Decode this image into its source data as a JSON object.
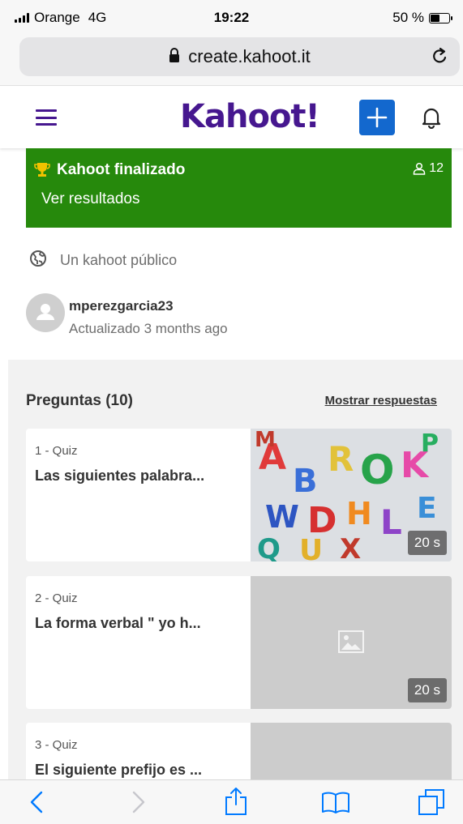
{
  "status_bar": {
    "carrier": "Orange",
    "network": "4G",
    "time": "19:22",
    "battery_text": "50 %",
    "battery_level": 0.5
  },
  "browser": {
    "url": "create.kahoot.it"
  },
  "header": {
    "logo": "Kahoot!",
    "logo_color": "#46178f",
    "plus_color": "#1368ce"
  },
  "banner": {
    "title": "Kahoot finalizado",
    "player_count": "12",
    "link": "Ver resultados",
    "color": "#26890c"
  },
  "visibility": {
    "label": "Un kahoot público"
  },
  "author": {
    "username": "mperezgarcia23",
    "updated": "Actualizado 3 months ago"
  },
  "questions": {
    "title": "Preguntas (10)",
    "show_answers": "Mostrar respuestas",
    "items": [
      {
        "type": "1 - Quiz",
        "title": "Las siguientes palabra...",
        "time": "20 s",
        "has_image": true
      },
      {
        "type": "2 - Quiz",
        "title": "La forma verbal \" yo h...",
        "time": "20 s",
        "has_image": false
      },
      {
        "type": "3 - Quiz",
        "title": "El siguiente prefijo es ...",
        "time": "",
        "has_image": false
      }
    ]
  },
  "toolbar": {
    "icons": [
      "back-icon",
      "forward-icon",
      "share-icon",
      "bookmarks-icon",
      "tabs-icon"
    ],
    "accent": "#007aff"
  }
}
